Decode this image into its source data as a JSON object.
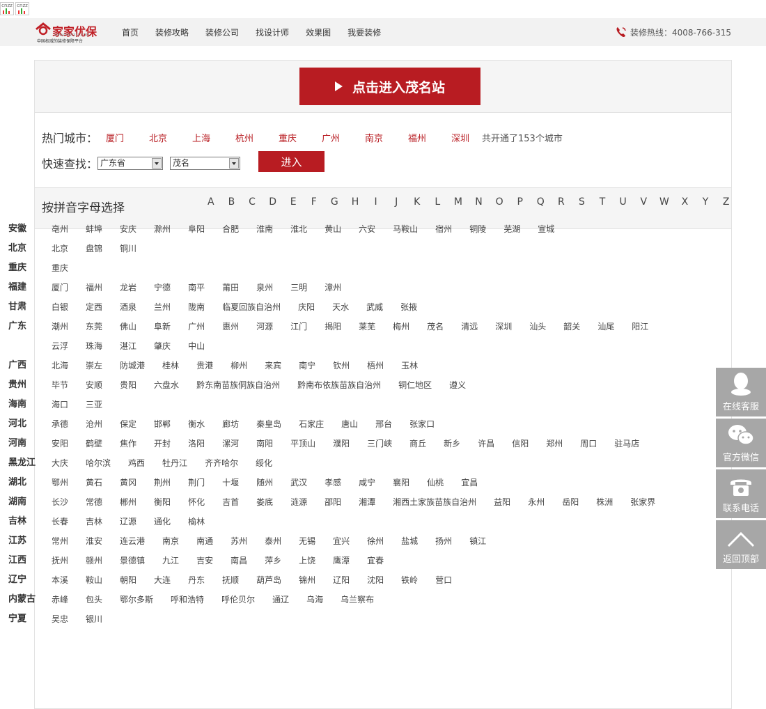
{
  "stat": {
    "a": "cnzz",
    "b": "cnzz"
  },
  "logo": {
    "brand": "家家优保",
    "url": "WWW.YBW315.COM",
    "tagline": "中国权威的装修保障平台"
  },
  "nav": [
    "首页",
    "装修攻略",
    "装修公司",
    "找设计师",
    "效果图",
    "我要装修"
  ],
  "hotline": "装修热线：4008-766-315",
  "enter_button": "点击进入茂名站",
  "hot": {
    "label": "热门城市：",
    "cities": [
      "厦门",
      "北京",
      "上海",
      "杭州",
      "重庆",
      "广州",
      "南京",
      "福州",
      "深圳"
    ],
    "total": "共开通了153个城市"
  },
  "quick": {
    "label": "快速查找：",
    "province": "广东省",
    "city": "茂名",
    "go": "进入"
  },
  "pinyin": {
    "label": "按拼音字母选择",
    "letters": [
      "A",
      "B",
      "C",
      "D",
      "E",
      "F",
      "G",
      "H",
      "I",
      "J",
      "K",
      "L",
      "M",
      "N",
      "O",
      "P",
      "Q",
      "R",
      "S",
      "T",
      "U",
      "V",
      "W",
      "X",
      "Y",
      "Z"
    ]
  },
  "provinces": [
    {
      "name": "安徽",
      "cities": [
        "亳州",
        "蚌埠",
        "安庆",
        "滁州",
        "阜阳",
        "合肥",
        "淮南",
        "淮北",
        "黄山",
        "六安",
        "马鞍山",
        "宿州",
        "铜陵",
        "芜湖",
        "宣城"
      ]
    },
    {
      "name": "北京",
      "cities": [
        "北京",
        "盘锦",
        "铜川"
      ]
    },
    {
      "name": "重庆",
      "cities": [
        "重庆"
      ]
    },
    {
      "name": "福建",
      "cities": [
        "厦门",
        "福州",
        "龙岩",
        "宁德",
        "南平",
        "莆田",
        "泉州",
        "三明",
        "漳州"
      ]
    },
    {
      "name": "甘肃",
      "cities": [
        "白银",
        "定西",
        "酒泉",
        "兰州",
        "陇南",
        "临夏回族自治州",
        "庆阳",
        "天水",
        "武威",
        "张掖"
      ]
    },
    {
      "name": "广东",
      "cities": [
        "潮州",
        "东莞",
        "佛山",
        "阜新",
        "广州",
        "惠州",
        "河源",
        "江门",
        "揭阳",
        "莱芜",
        "梅州",
        "茂名",
        "清远",
        "深圳",
        "汕头",
        "韶关",
        "汕尾",
        "阳江",
        "云浮",
        "珠海",
        "湛江",
        "肇庆",
        "中山"
      ]
    },
    {
      "name": "广西",
      "cities": [
        "北海",
        "崇左",
        "防城港",
        "桂林",
        "贵港",
        "柳州",
        "来宾",
        "南宁",
        "钦州",
        "梧州",
        "玉林"
      ]
    },
    {
      "name": "贵州",
      "cities": [
        "毕节",
        "安顺",
        "贵阳",
        "六盘水",
        "黔东南苗族侗族自治州",
        "黔南布依族苗族自治州",
        "铜仁地区",
        "遵义"
      ]
    },
    {
      "name": "海南",
      "cities": [
        "海口",
        "三亚"
      ]
    },
    {
      "name": "河北",
      "cities": [
        "承德",
        "沧州",
        "保定",
        "邯郸",
        "衡水",
        "廊坊",
        "秦皇岛",
        "石家庄",
        "唐山",
        "邢台",
        "张家口"
      ]
    },
    {
      "name": "河南",
      "cities": [
        "安阳",
        "鹤壁",
        "焦作",
        "开封",
        "洛阳",
        "漯河",
        "南阳",
        "平顶山",
        "濮阳",
        "三门峡",
        "商丘",
        "新乡",
        "许昌",
        "信阳",
        "郑州",
        "周口",
        "驻马店"
      ]
    },
    {
      "name": "黑龙江",
      "cities": [
        "大庆",
        "哈尔滨",
        "鸡西",
        "牡丹江",
        "齐齐哈尔",
        "绥化"
      ]
    },
    {
      "name": "湖北",
      "cities": [
        "鄂州",
        "黄石",
        "黄冈",
        "荆州",
        "荆门",
        "十堰",
        "随州",
        "武汉",
        "孝感",
        "咸宁",
        "襄阳",
        "仙桃",
        "宜昌"
      ]
    },
    {
      "name": "湖南",
      "cities": [
        "长沙",
        "常德",
        "郴州",
        "衡阳",
        "怀化",
        "吉首",
        "娄底",
        "涟源",
        "邵阳",
        "湘潭",
        "湘西土家族苗族自治州",
        "益阳",
        "永州",
        "岳阳",
        "株洲",
        "张家界"
      ]
    },
    {
      "name": "吉林",
      "cities": [
        "长春",
        "吉林",
        "辽源",
        "通化",
        "榆林"
      ]
    },
    {
      "name": "江苏",
      "cities": [
        "常州",
        "淮安",
        "连云港",
        "南京",
        "南通",
        "苏州",
        "泰州",
        "无锡",
        "宜兴",
        "徐州",
        "盐城",
        "扬州",
        "镇江"
      ]
    },
    {
      "name": "江西",
      "cities": [
        "抚州",
        "赣州",
        "景德镇",
        "九江",
        "吉安",
        "南昌",
        "萍乡",
        "上饶",
        "鹰潭",
        "宜春"
      ]
    },
    {
      "name": "辽宁",
      "cities": [
        "本溪",
        "鞍山",
        "朝阳",
        "大连",
        "丹东",
        "抚顺",
        "葫芦岛",
        "锦州",
        "辽阳",
        "沈阳",
        "铁岭",
        "营口"
      ]
    },
    {
      "name": "内蒙古",
      "cities": [
        "赤峰",
        "包头",
        "鄂尔多斯",
        "呼和浩特",
        "呼伦贝尔",
        "通辽",
        "乌海",
        "乌兰察布"
      ]
    },
    {
      "name": "宁夏",
      "cities": [
        "吴忠",
        "银川"
      ]
    }
  ],
  "side": {
    "service": "在线客服",
    "wechat": "官方微信",
    "phone": "联系电话",
    "top": "返回顶部"
  },
  "colors": {
    "brand": "#b81c22",
    "side": "#a7a7a7"
  }
}
